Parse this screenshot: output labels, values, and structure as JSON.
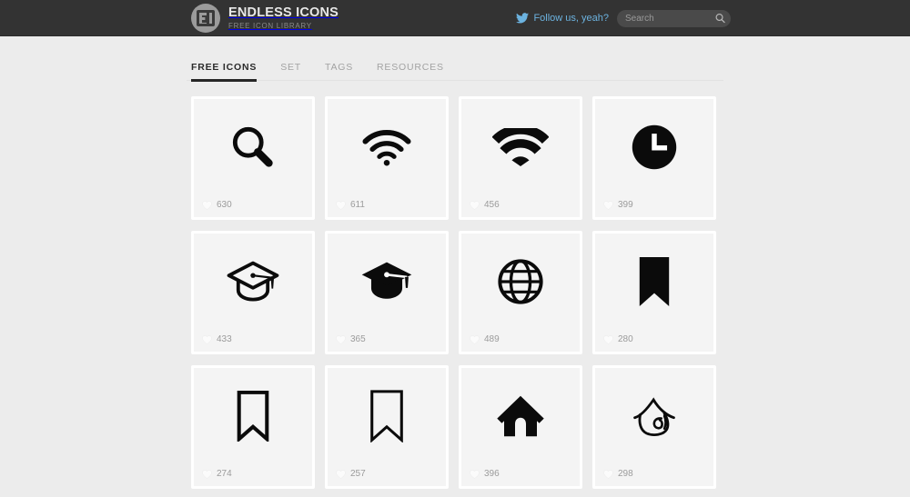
{
  "header": {
    "brand": {
      "title": "ENDLESS ICONS",
      "subtitle": "FREE ICON LIBRARY",
      "logo_icon": "endless-icons-logo"
    },
    "twitter": {
      "label": "Follow us, yeah?",
      "icon": "twitter-bird-icon",
      "color": "#6cb3e0"
    },
    "search": {
      "placeholder": "Search",
      "value": "",
      "icon": "search-icon"
    },
    "background_color": "#333333"
  },
  "nav": {
    "items": [
      {
        "label": "FREE ICONS",
        "active": true
      },
      {
        "label": "SET",
        "active": false
      },
      {
        "label": "TAGS",
        "active": false
      },
      {
        "label": "RESOURCES",
        "active": false
      }
    ]
  },
  "page": {
    "background_color": "#ececec",
    "card_background_color": "#f4f4f4",
    "card_border_color": "#ffffff",
    "like_text_color": "#9b9b9b"
  },
  "icons": [
    {
      "name": "magnifier-search-icon",
      "glyph": "magnifier",
      "likes": "630"
    },
    {
      "name": "wifi-signal-thin-icon",
      "glyph": "wifi-thin",
      "likes": "611"
    },
    {
      "name": "wifi-signal-bold-icon",
      "glyph": "wifi-bold",
      "likes": "456"
    },
    {
      "name": "clock-filled-icon",
      "glyph": "clock",
      "likes": "399"
    },
    {
      "name": "graduation-cap-outline-icon",
      "glyph": "cap-outline",
      "likes": "433"
    },
    {
      "name": "graduation-cap-filled-icon",
      "glyph": "cap-filled",
      "likes": "365"
    },
    {
      "name": "globe-outline-icon",
      "glyph": "globe",
      "likes": "489"
    },
    {
      "name": "bookmark-filled-icon",
      "glyph": "bookmark-filled",
      "likes": "280"
    },
    {
      "name": "bookmark-outline-icon",
      "glyph": "bookmark-outline",
      "likes": "274"
    },
    {
      "name": "bookmark-outline-thin-icon",
      "glyph": "bookmark-outline-thin",
      "likes": "257"
    },
    {
      "name": "home-filled-icon",
      "glyph": "home-filled",
      "likes": "396"
    },
    {
      "name": "home-sketch-icon",
      "glyph": "home-sketch",
      "likes": "298"
    }
  ]
}
